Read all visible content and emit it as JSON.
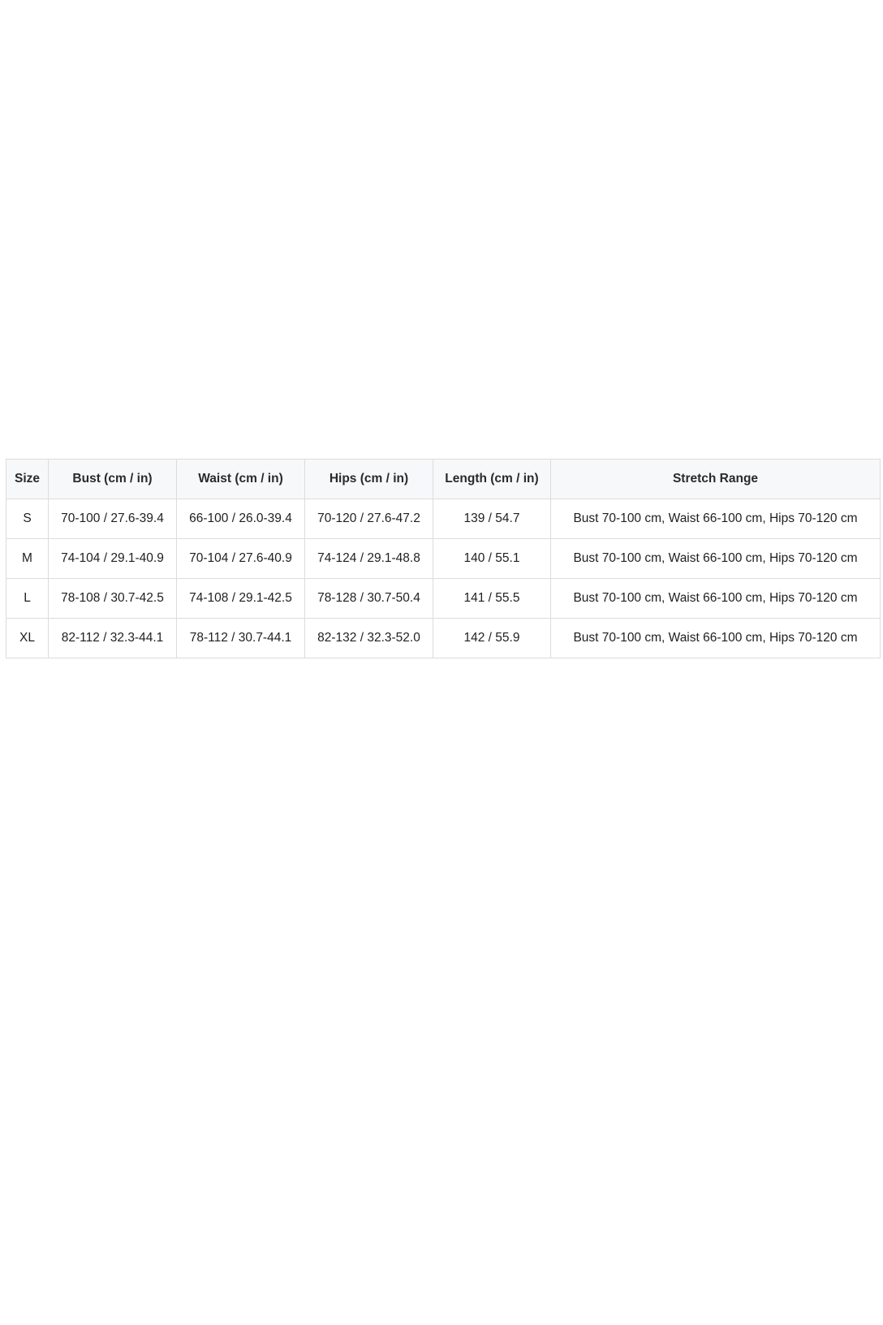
{
  "table": {
    "headers": [
      "Size",
      "Bust (cm / in)",
      "Waist (cm / in)",
      "Hips (cm / in)",
      "Length (cm / in)",
      "Stretch Range"
    ],
    "rows": [
      [
        "S",
        "70-100 / 27.6-39.4",
        "66-100 / 26.0-39.4",
        "70-120 / 27.6-47.2",
        "139 / 54.7",
        "Bust 70-100 cm, Waist 66-100 cm, Hips 70-120 cm"
      ],
      [
        "M",
        "74-104 / 29.1-40.9",
        "70-104 / 27.6-40.9",
        "74-124 / 29.1-48.8",
        "140 / 55.1",
        "Bust 70-100 cm, Waist 66-100 cm, Hips 70-120 cm"
      ],
      [
        "L",
        "78-108 / 30.7-42.5",
        "74-108 / 29.1-42.5",
        "78-128 / 30.7-50.4",
        "141 / 55.5",
        "Bust 70-100 cm, Waist 66-100 cm, Hips 70-120 cm"
      ],
      [
        "XL",
        "82-112 / 32.3-44.1",
        "78-112 / 30.7-44.1",
        "82-132 / 32.3-52.0",
        "142 / 55.9",
        "Bust 70-100 cm, Waist 66-100 cm, Hips 70-120 cm"
      ]
    ]
  }
}
